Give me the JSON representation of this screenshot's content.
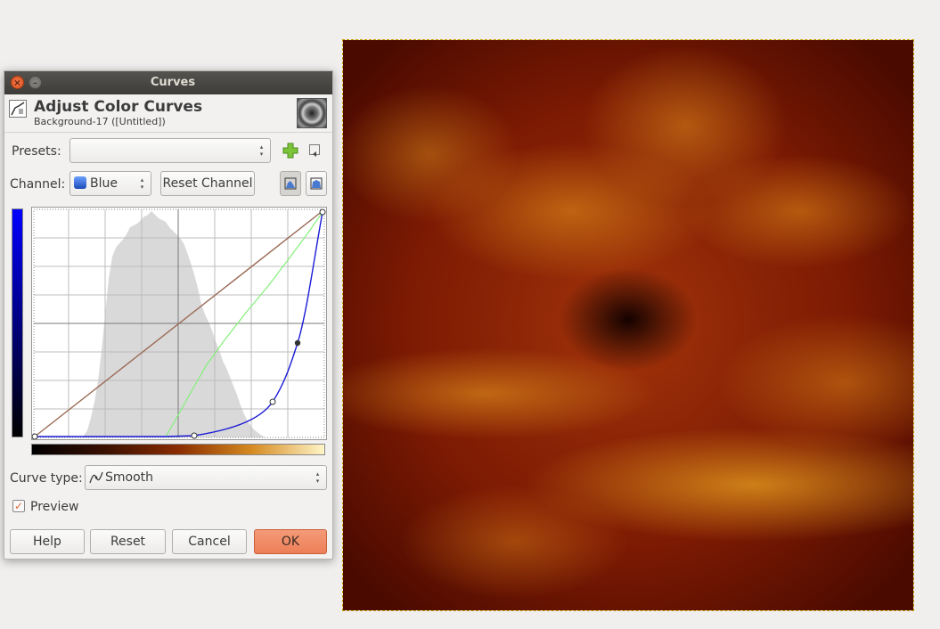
{
  "dialog": {
    "window_title": "Curves",
    "close_glyph": "×",
    "minimize_glyph": "–",
    "header_title": "Adjust Color Curves",
    "header_subtitle": "Background-17 ([Untitled])",
    "presets": {
      "label": "Presets:",
      "value": ""
    },
    "channel": {
      "label": "Channel:",
      "value": "Blue",
      "reset_label": "Reset Channel"
    },
    "curve_type": {
      "label": "Curve type:",
      "value": "Smooth"
    },
    "preview": {
      "label": "Preview",
      "checked": true,
      "check_glyph": "✓"
    },
    "buttons": {
      "help": "Help",
      "reset": "Reset",
      "cancel": "Cancel",
      "ok": "OK"
    },
    "icons": [
      "add-preset-icon",
      "preset-menu-icon",
      "channel-color-icon",
      "linear-histogram-icon",
      "log-histogram-icon",
      "smooth-curve-icon",
      "tool-curves-icon"
    ]
  },
  "colors": {
    "blue_curve": "#1a1ad6",
    "green_curve": "#84f07a",
    "value_curve": "#9a6a55",
    "histogram": "#d9d9d9",
    "accent": "#ec7f58"
  }
}
